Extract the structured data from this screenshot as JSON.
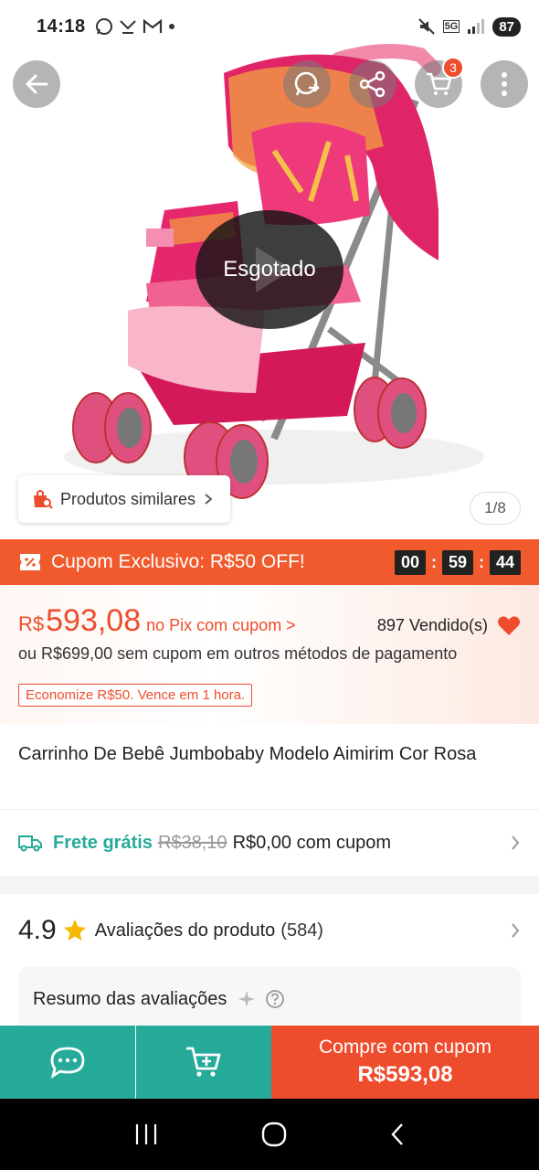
{
  "status_bar": {
    "time": "14:18",
    "network": "5G",
    "battery": "87"
  },
  "product_image": {
    "overlay": "Esgotado",
    "counter": "1/8",
    "cart_count": "3",
    "similar_button": "Produtos similares"
  },
  "coupon": {
    "text": "Cupom Exclusivo: R$50 OFF!",
    "timer_h": "00",
    "timer_m": "59",
    "timer_s": "44"
  },
  "price": {
    "currency": "R$",
    "value": "593,08",
    "note": "no Pix com cupom >",
    "sold": "897 Vendido(s)",
    "alt": "ou R$699,00 sem cupom em outros métodos de pagamento",
    "save_tag": "Economize R$50. Vence em 1 hora."
  },
  "title": "Carrinho De Bebê Jumbobaby Modelo Aimirim Cor Rosa",
  "shipping": {
    "free": "Frete grátis",
    "old": "R$38,10",
    "new": "R$0,00 com cupom"
  },
  "reviews": {
    "rating": "4.9",
    "label": "Avaliações do produto",
    "count": "(584)",
    "summary": "Resumo das avaliações"
  },
  "action_bar": {
    "buy_label": "Compre com cupom",
    "buy_price": "R$593,08"
  },
  "colors": {
    "brand": "#ee4d2d",
    "accent_teal": "#26aa99"
  }
}
